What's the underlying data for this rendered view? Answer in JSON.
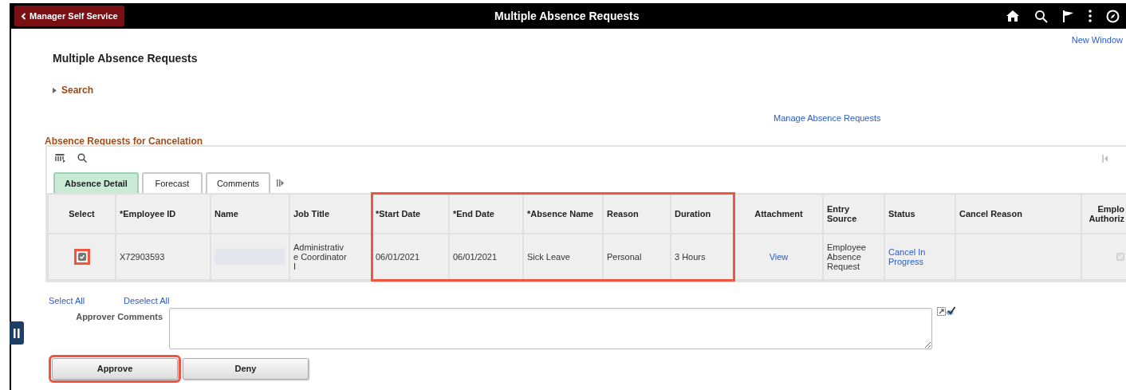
{
  "header": {
    "back_button": "Manager Self Service",
    "title": "Multiple Absence Requests"
  },
  "new_window_link": "New Window",
  "page_title": "Multiple Absence Requests",
  "search": {
    "label": "Search",
    "expanded": false
  },
  "manage_link": "Manage Absence Requests",
  "grid": {
    "title": "Absence Requests for Cancelation",
    "tabs": [
      {
        "label": "Absence Detail",
        "selected": true
      },
      {
        "label": "Forecast",
        "selected": false
      },
      {
        "label": "Comments",
        "selected": false
      }
    ],
    "columns": [
      {
        "label": "Select",
        "highlighted": false
      },
      {
        "label": "*Employee ID",
        "highlighted": false
      },
      {
        "label": "Name",
        "highlighted": false
      },
      {
        "label": "Job Title",
        "highlighted": false
      },
      {
        "label": "*Start Date",
        "highlighted": true
      },
      {
        "label": "*End Date",
        "highlighted": true
      },
      {
        "label": "*Absence Name",
        "highlighted": true
      },
      {
        "label": "Reason",
        "highlighted": true
      },
      {
        "label": "Duration",
        "highlighted": true
      },
      {
        "label": "Attachment",
        "highlighted": false
      },
      {
        "label": "Entry\nSource",
        "highlighted": false
      },
      {
        "label": "Status",
        "highlighted": false
      },
      {
        "label": "Cancel Reason",
        "highlighted": false
      },
      {
        "label": "Emplo\nAuthoriz",
        "highlighted": false
      }
    ],
    "rows": [
      {
        "cells": [
          {
            "kind": "checkbox",
            "checked": true,
            "disabled": false,
            "highlighted": true
          },
          {
            "kind": "text",
            "text": "X72903593"
          },
          {
            "kind": "redacted"
          },
          {
            "kind": "text",
            "text": "Administrativ\ne Coordinator\nI"
          },
          {
            "kind": "text",
            "text": "06/01/2021"
          },
          {
            "kind": "text",
            "text": "06/01/2021"
          },
          {
            "kind": "text",
            "text": "Sick Leave"
          },
          {
            "kind": "text",
            "text": "Personal"
          },
          {
            "kind": "text",
            "text": "3 Hours"
          },
          {
            "kind": "link",
            "text": "View"
          },
          {
            "kind": "text",
            "text": "Employee\nAbsence\nRequest"
          },
          {
            "kind": "link",
            "text": "Cancel In\nProgress"
          },
          {
            "kind": "empty"
          },
          {
            "kind": "checkbox",
            "checked": true,
            "disabled": true
          }
        ]
      }
    ]
  },
  "select_all": "Select All",
  "deselect_all": "Deselect All",
  "comments": {
    "label": "Approver Comments"
  },
  "buttons": [
    {
      "label": "Approve",
      "highlighted": true
    },
    {
      "label": "Deny",
      "highlighted": false
    }
  ]
}
